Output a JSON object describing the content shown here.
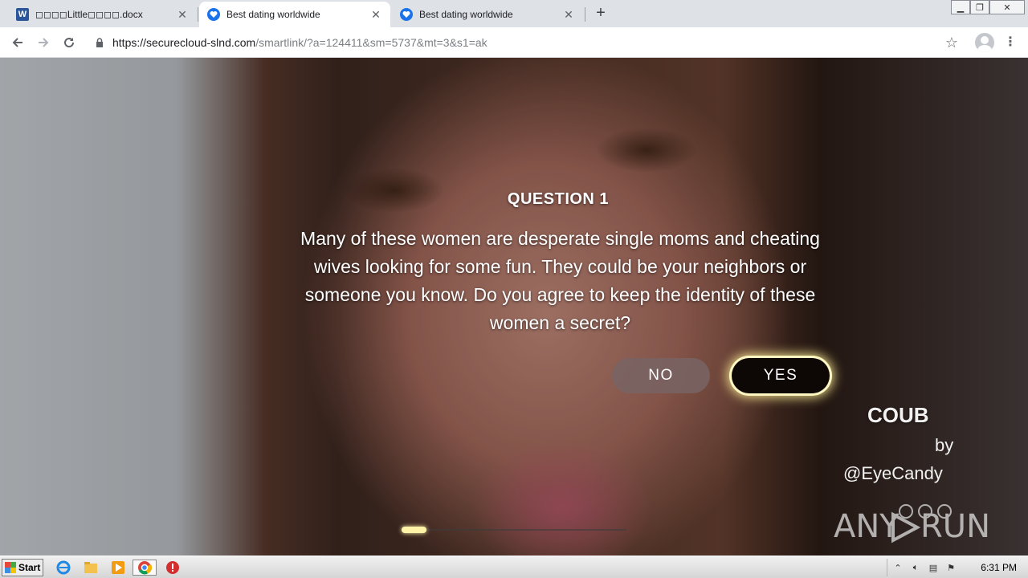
{
  "browser": {
    "tabs": [
      {
        "title": "◻◻◻◻Little◻◻◻◻.docx",
        "icon": "word-icon",
        "active": false
      },
      {
        "title": "Best dating worldwide",
        "icon": "heart-shield-icon",
        "active": true
      },
      {
        "title": "Best dating worldwide",
        "icon": "heart-shield-icon",
        "active": false
      }
    ],
    "url": {
      "host": "https://securecloud-slnd.com",
      "path": "/smartlink/?a=124411&sm=5737&mt=3&s1=ak"
    }
  },
  "quiz": {
    "title": "QUESTION 1",
    "text": "Many of these women are desperate single moms and cheating wives looking for some fun. They could be your neighbors or someone you know. Do you agree to keep the identity of these women a secret?",
    "no_label": "NO",
    "yes_label": "YES",
    "progress_fraction": 0.11
  },
  "overlay": {
    "brand": "COUB",
    "by": "by",
    "handle": "@EyeCandy",
    "watermark": "ANY RUN"
  },
  "taskbar": {
    "start_label": "Start",
    "clock": "6:31 PM"
  },
  "colors": {
    "accent_glow": "#fff3a8",
    "yes_bg": "#0d0706",
    "tab_active": "#ffffff",
    "tabstrip_bg": "#dee1e6"
  }
}
